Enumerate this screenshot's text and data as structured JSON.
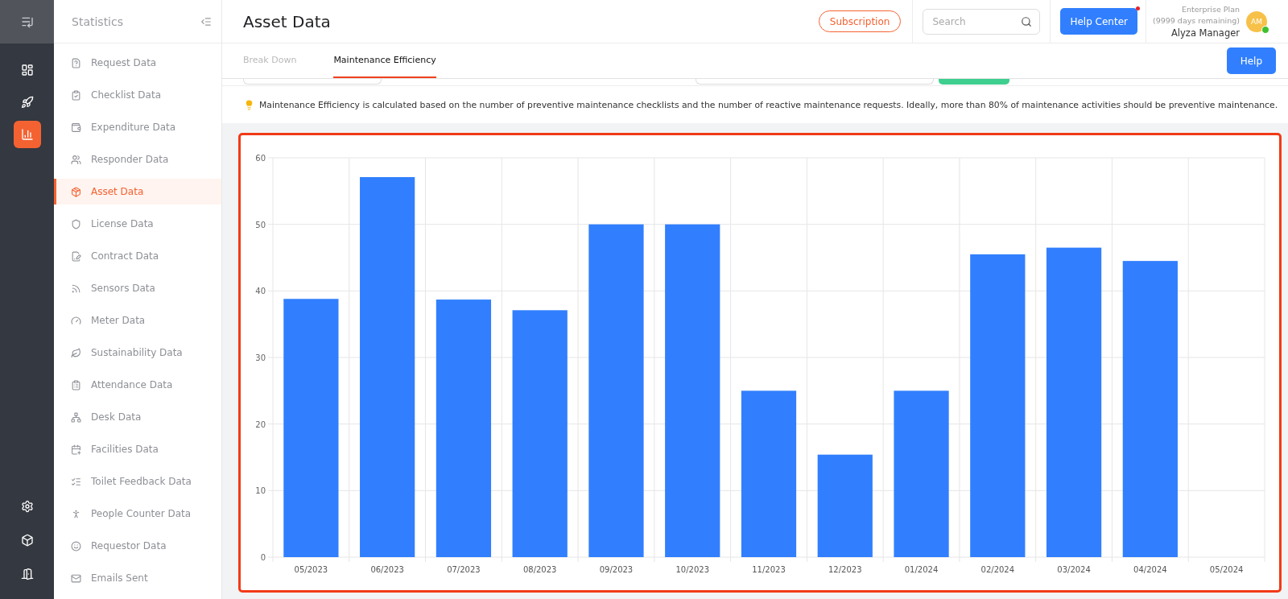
{
  "rail": {
    "items": [
      {
        "kind": "dashboard",
        "selected": false
      },
      {
        "kind": "rocket",
        "selected": false
      },
      {
        "kind": "stats",
        "selected": true
      }
    ],
    "bottom": [
      {
        "kind": "settings"
      },
      {
        "kind": "box"
      },
      {
        "kind": "exit"
      }
    ]
  },
  "sidebar": {
    "title": "Statistics",
    "items": [
      {
        "label": "Request Data",
        "selected": false
      },
      {
        "label": "Checklist Data",
        "selected": false
      },
      {
        "label": "Expenditure Data",
        "selected": false
      },
      {
        "label": "Responder Data",
        "selected": false
      },
      {
        "label": "Asset Data",
        "selected": true
      },
      {
        "label": "License Data",
        "selected": false
      },
      {
        "label": "Contract Data",
        "selected": false
      },
      {
        "label": "Sensors Data",
        "selected": false
      },
      {
        "label": "Meter Data",
        "selected": false
      },
      {
        "label": "Sustainability Data",
        "selected": false
      },
      {
        "label": "Attendance Data",
        "selected": false
      },
      {
        "label": "Desk Data",
        "selected": false
      },
      {
        "label": "Facilities Data",
        "selected": false
      },
      {
        "label": "Toilet Feedback Data",
        "selected": false
      },
      {
        "label": "People Counter Data",
        "selected": false
      },
      {
        "label": "Requestor Data",
        "selected": false
      },
      {
        "label": "Emails Sent",
        "selected": false
      }
    ]
  },
  "header": {
    "title": "Asset Data",
    "subscription": "Subscription",
    "search": {
      "placeholder": "Search"
    },
    "help_center": "Help Center",
    "plan": "Enterprise Plan",
    "days": "(9999 days remaining)",
    "user": "Alyza Manager",
    "avatar": "AM",
    "online": true
  },
  "tabs": [
    {
      "label": "Break Down",
      "selected": false
    },
    {
      "label": "Maintenance Efficiency",
      "selected": true
    }
  ],
  "help_button": "Help",
  "info": "Maintenance Efficiency is calculated based on the number of preventive maintenance checklists and the number of reactive maintenance requests. Ideally, more than 80% of maintenance activities should be preventive maintenance.",
  "chart": {
    "chart_data": {
      "type": "bar",
      "grid": true,
      "categories": [
        "05/2023",
        "06/2023",
        "07/2023",
        "08/2023",
        "09/2023",
        "10/2023",
        "11/2023",
        "12/2023",
        "01/2024",
        "02/2024",
        "03/2024",
        "04/2024",
        "05/2024"
      ],
      "series": [
        {
          "color": "#317ffe",
          "values": [
            38.8,
            57.1,
            38.7,
            37.1,
            50,
            50,
            25,
            15.4,
            25,
            45.5,
            46.5,
            44.5,
            null
          ]
        }
      ],
      "ylim": [
        0,
        60
      ],
      "yticks": [
        0,
        10,
        20,
        30,
        40,
        50,
        60
      ]
    }
  }
}
